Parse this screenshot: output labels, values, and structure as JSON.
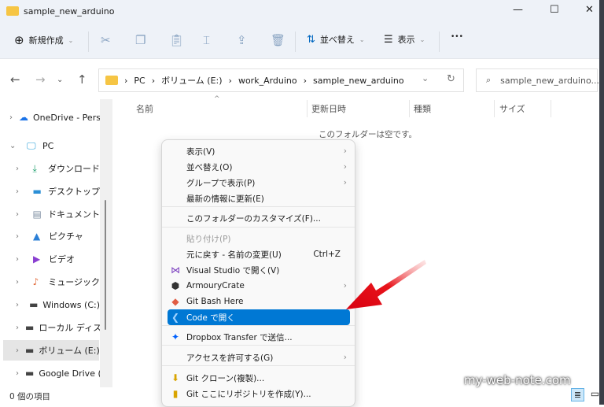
{
  "window": {
    "title": "sample_new_arduino",
    "minimize": "—",
    "maximize": "☐",
    "close": "✕"
  },
  "toolbar": {
    "new_label": "新規作成",
    "sort_label": "並べ替え",
    "view_label": "表示",
    "more": "•••"
  },
  "address": {
    "segments": [
      "PC",
      "ボリューム (E:)",
      "work_Arduino",
      "sample_new_arduino"
    ],
    "separator": "›"
  },
  "search": {
    "placeholder": "sample_new_arduino..."
  },
  "columns": [
    "名前",
    "更新日時",
    "種類",
    "サイズ"
  ],
  "empty_text": "このフォルダーは空です。",
  "sidebar": {
    "items": [
      {
        "label": "OneDrive - Personal",
        "icon": "cloud-icon",
        "expanded": false
      },
      {
        "label": "PC",
        "icon": "monitor-icon",
        "expanded": true
      },
      {
        "label": "ダウンロード",
        "icon": "download-icon"
      },
      {
        "label": "デスクトップ",
        "icon": "desktop-icon"
      },
      {
        "label": "ドキュメント",
        "icon": "document-icon"
      },
      {
        "label": "ピクチャ",
        "icon": "pictures-icon"
      },
      {
        "label": "ビデオ",
        "icon": "video-icon"
      },
      {
        "label": "ミュージック",
        "icon": "music-icon"
      },
      {
        "label": "Windows (C:)",
        "icon": "drive-icon"
      },
      {
        "label": "ローカル ディスク (D:)",
        "icon": "drive-icon"
      },
      {
        "label": "ボリューム (E:)",
        "icon": "drive-icon",
        "selected": true
      },
      {
        "label": "Google Drive (G:)",
        "icon": "drive-icon"
      }
    ]
  },
  "status": {
    "item_count": "0 個の項目"
  },
  "context_menu": {
    "items": [
      {
        "label": "表示(V)",
        "submenu": true
      },
      {
        "label": "並べ替え(O)",
        "submenu": true
      },
      {
        "label": "グループで表示(P)",
        "submenu": true
      },
      {
        "label": "最新の情報に更新(E)"
      },
      {
        "label": "このフォルダーのカスタマイズ(F)..."
      },
      {
        "label": "貼り付け(P)",
        "disabled": true
      },
      {
        "label": "元に戻す - 名前の変更(U)",
        "shortcut": "Ctrl+Z"
      },
      {
        "label": "Visual Studio で開く(V)",
        "icon": "visual-studio-icon"
      },
      {
        "label": "ArmouryCrate",
        "icon": "armoury-crate-icon",
        "submenu": true
      },
      {
        "label": "Git Bash Here",
        "icon": "git-bash-icon"
      },
      {
        "label": "Code で開く",
        "icon": "vscode-icon",
        "highlighted": true
      },
      {
        "label": "Dropbox Transfer で送信...",
        "icon": "dropbox-icon"
      },
      {
        "label": "アクセスを許可する(G)",
        "submenu": true
      },
      {
        "label": "Git クローン(複製)...",
        "icon": "git-clone-icon"
      },
      {
        "label": "Git ここにリポジトリを作成(Y)...",
        "icon": "git-init-icon"
      }
    ]
  },
  "watermark": "my-web-note.com",
  "colors": {
    "accent": "#0078d4",
    "arrow": "#e8141b"
  }
}
